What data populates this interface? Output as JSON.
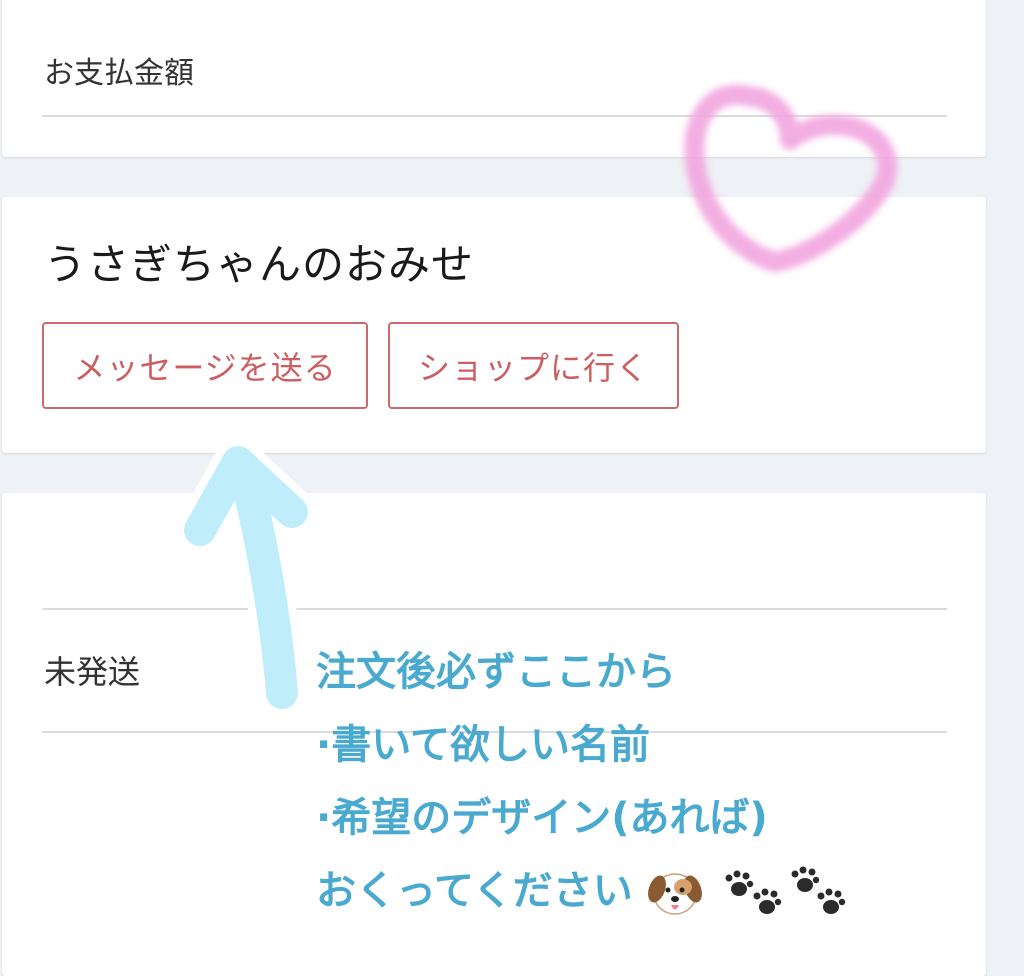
{
  "payment": {
    "label": "お支払金額"
  },
  "shop": {
    "name": "うさぎちゃんのおみせ",
    "message_button": "メッセージを送る",
    "shop_button": "ショップに行く"
  },
  "status": {
    "label": "未発送"
  },
  "annotation": {
    "lines": [
      "注文後必ずここから",
      "·書いて欲しい名前",
      "·希望のデザイン(あれば)",
      "おくってください"
    ]
  },
  "colors": {
    "button_border": "#d0686b",
    "annotation_text": "#4aa9cf",
    "arrow": "#bfeefa",
    "heart_scribble": "#f2a6df"
  },
  "icons": [
    "dog-face-emoji",
    "paw-prints-emoji",
    "up-arrow-drawing",
    "heart-scribble-drawing"
  ]
}
